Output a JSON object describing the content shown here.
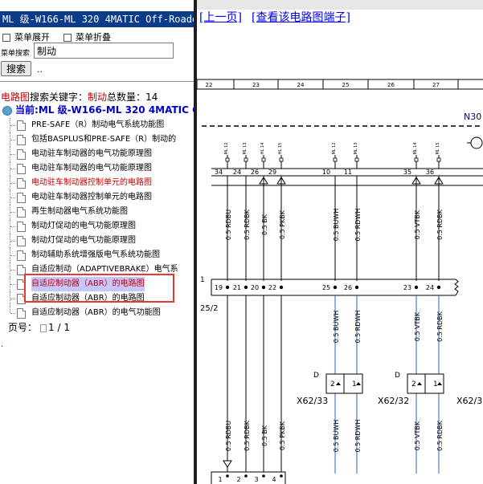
{
  "left": {
    "title": "ML 级-W166-ML 320 4MATIC Off-Roader /",
    "expand_label": "菜单展开",
    "collapse_label": "菜单折叠",
    "search_label": "菜单搜索",
    "search_value": "制动",
    "search_button": "搜索",
    "dots": "..",
    "result_prefix": "电路图",
    "result_mid": "搜索关键字：",
    "result_keyword": "制动",
    "result_count_label": "总数量：",
    "result_count": "14",
    "current_label": "当前:",
    "current_path": "ML 级-W166-ML 320 4MATIC Off",
    "items": [
      {
        "label": "PRE-SAFE（R）制动电气系统功能图",
        "style": "normal"
      },
      {
        "label": "包括BASPLUS和PRE-SAFE（R）制动的",
        "style": "normal"
      },
      {
        "label": "电动驻车制动器的电气功能原理图",
        "style": "normal"
      },
      {
        "label": "电动驻车制动器的电气功能原理图",
        "style": "normal"
      },
      {
        "label": "电动驻车制动器控制单元的电路图",
        "style": "red"
      },
      {
        "label": "电动驻车制动器控制单元的电路图",
        "style": "normal"
      },
      {
        "label": "再生制动器电气系统功能图",
        "style": "normal"
      },
      {
        "label": "制动灯促动的电气功能原理图",
        "style": "normal"
      },
      {
        "label": "制动灯促动的电气功能原理图",
        "style": "normal"
      },
      {
        "label": "制动辅助系统增强版电气系统功能图",
        "style": "normal"
      },
      {
        "label": "自适应制动（ADAPTIVEBRAKE）电气系",
        "style": "normal"
      },
      {
        "label": "自适应制动器（ABR）的电路图",
        "style": "highlight"
      },
      {
        "label": "自适应制动器（ABR）的电路图",
        "style": "normal"
      },
      {
        "label": "自适应制动器（ABR）的电气功能图",
        "style": "normal"
      }
    ],
    "page_label": "页号：",
    "page_value": "1 / 1",
    "stray": "."
  },
  "right": {
    "prev_link": "[上一页]",
    "terminal_link": "[查看该电路图端子]"
  },
  "diagram": {
    "grid_numbers": [
      "22",
      "23",
      "24",
      "25",
      "26",
      "27"
    ],
    "connector_label": "N30",
    "top_pins": [
      "34",
      "24",
      "26",
      "29",
      "10",
      "11",
      "35",
      "36"
    ],
    "top_codes": [
      "ML 12",
      "ML 13",
      "HL 14",
      "HL 15",
      "ML 12",
      "ML 13",
      "ML 14",
      "ML 15"
    ],
    "top_wires": [
      "0.5 RDBU",
      "0.5 RDBK",
      "0.5 BK",
      "0.5 PKBK",
      "0.5 BUWH",
      "0.5 RDWH",
      "0.5 VTBK",
      "0.5 RDBK"
    ],
    "side_number": "1",
    "side_label": "25/2",
    "splice_pins": [
      "19",
      "21",
      "20",
      "22",
      "25",
      "26",
      "23",
      "24"
    ],
    "mid_wires": [
      "0.5 BUWH",
      "0.5 RDWH",
      "0.5 VTBK",
      "0.5 RDBK"
    ],
    "d_label": "D",
    "conn_pins": [
      "2",
      "1"
    ],
    "conn_names": [
      "X62/33",
      "X62/32",
      "X62/3("
    ],
    "bottom_wires": [
      "0.5 RDBU",
      "0.5 RDBK",
      "0.5 BK",
      "0.5 PKBK",
      "0.5 BUWH",
      "0.5 RDWH",
      "0.5 VTBK",
      "0.5 RDBK"
    ],
    "bottom_pins": [
      "1",
      "2",
      "3",
      "4"
    ]
  }
}
